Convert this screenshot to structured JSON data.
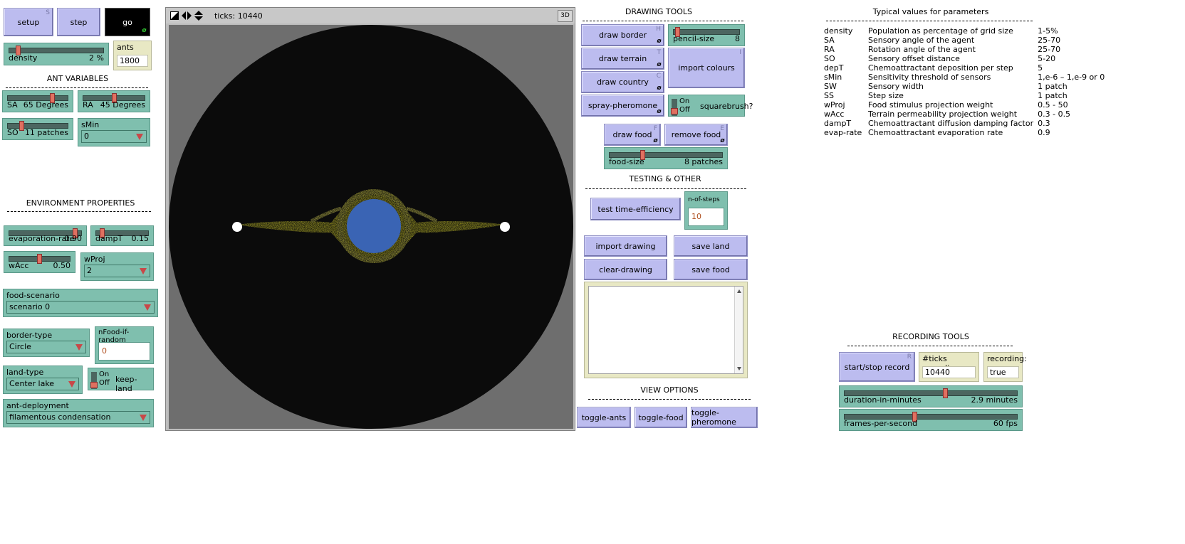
{
  "buttons": {
    "setup": {
      "label": "setup",
      "key": "S"
    },
    "step": {
      "label": "step"
    },
    "go": {
      "label": "go"
    }
  },
  "ants_monitor": {
    "label": "ants",
    "value": "1800"
  },
  "density": {
    "label": "density",
    "value": "2 %",
    "level": 0.02
  },
  "ant_variables_title": "ANT VARIABLES",
  "sa": {
    "label": "SA",
    "value": "65 Degrees",
    "level": 0.6
  },
  "ra": {
    "label": "RA",
    "value": "45 Degrees",
    "level": 0.45
  },
  "so": {
    "label": "SO",
    "value": "11 patches",
    "level": 0.2
  },
  "smin": {
    "label": "sMin",
    "value": "0"
  },
  "env_title": "ENVIRONMENT PROPERTIES",
  "evaporation": {
    "label": "evaporation-rate",
    "value": "0.90",
    "level": 0.9
  },
  "dampT": {
    "label": "dampT",
    "value": "0.15",
    "level": 0.05
  },
  "wAcc": {
    "label": "wAcc",
    "value": "0.50",
    "level": 0.5
  },
  "wProj": {
    "label": "wProj",
    "value": "2"
  },
  "food_scenario": {
    "label": "food-scenario",
    "value": "scenario 0"
  },
  "border_type": {
    "label": "border-type",
    "value": "Circle"
  },
  "nfood": {
    "label": "nFood-if-random",
    "value": "0"
  },
  "land_type": {
    "label": "land-type",
    "value": "Center lake"
  },
  "keep_land": {
    "label": "keep-land",
    "on": "On",
    "off": "Off"
  },
  "ant_deployment": {
    "label": "ant-deployment",
    "value": "filamentous condensation"
  },
  "view": {
    "ticks_label": "ticks: 10440",
    "three_d": "3D"
  },
  "drawing_title": "DRAWING TOOLS",
  "draw_border": {
    "label": "draw border",
    "key": "H"
  },
  "draw_terrain": {
    "label": "draw terrain",
    "key": "T"
  },
  "draw_country": {
    "label": "draw country",
    "key": "C"
  },
  "spray_pheromone": {
    "label": "spray-pheromone"
  },
  "pencil_size": {
    "label": "pencil-size",
    "value": "8",
    "level": 0.05
  },
  "import_colours": {
    "label": "import colours",
    "key": "I"
  },
  "squarebrush": {
    "label": "squarebrush?",
    "on": "On",
    "off": "Off"
  },
  "draw_food": {
    "label": "draw food",
    "key": "F"
  },
  "remove_food": {
    "label": "remove food",
    "key": "E"
  },
  "food_size": {
    "label": "food-size",
    "value": "8 patches",
    "level": 0.3
  },
  "testing_title": "TESTING & OTHER",
  "test_time": {
    "label": "test time-efficiency"
  },
  "n_of_steps": {
    "label": "n-of-steps",
    "value": "10"
  },
  "import_drawing": {
    "label": "import drawing"
  },
  "save_land": {
    "label": "save land"
  },
  "clear_drawing": {
    "label": "clear-drawing"
  },
  "save_food": {
    "label": "save food"
  },
  "view_options_title": "VIEW OPTIONS",
  "toggle_ants": {
    "label": "toggle-ants"
  },
  "toggle_food": {
    "label": "toggle-food"
  },
  "toggle_pheromone": {
    "label": "toggle-pheromone"
  },
  "params_title": "Typical values for parameters",
  "params": [
    {
      "name": "density",
      "desc": "Population as percentage of grid size",
      "value": "1-5%"
    },
    {
      "name": "SA",
      "desc": "Sensory angle of the agent",
      "value": "25-70"
    },
    {
      "name": "RA",
      "desc": "Rotation angle of the agent",
      "value": "25-70"
    },
    {
      "name": "SO",
      "desc": "Sensory offset distance",
      "value": "5-20"
    },
    {
      "name": "depT",
      "desc": "Chemoattractant deposition per step",
      "value": "5"
    },
    {
      "name": "sMin",
      "desc": "Sensitivity threshold of sensors",
      "value": "1,e-6 – 1,e-9 or 0"
    },
    {
      "name": "SW",
      "desc": "Sensory width",
      "value": "1 patch"
    },
    {
      "name": "SS",
      "desc": "Step size",
      "value": "1 patch"
    },
    {
      "name": "wProj",
      "desc": "Food stimulus projection weight",
      "value": "0.5 - 50"
    },
    {
      "name": "wAcc",
      "desc": "Terrain permeability projection weight",
      "value": "0.3 - 0.5"
    },
    {
      "name": "dampT",
      "desc": "Chemoattractant diffusion damping factor",
      "value": "0.3"
    },
    {
      "name": "evap-rate",
      "desc": "Chemoattractant evaporation rate",
      "value": "0.9"
    }
  ],
  "recording_title": "RECORDING TOOLS",
  "start_stop": {
    "label": "start/stop record",
    "key": "R"
  },
  "ticks_recording": {
    "label": "#ticks recording:",
    "value": "10440"
  },
  "recording": {
    "label": "recording:",
    "value": "true"
  },
  "duration": {
    "label": "duration-in-minutes",
    "value": "2.9 minutes",
    "level": 0.58
  },
  "fps": {
    "label": "frames-per-second",
    "value": "60 fps",
    "level": 0.41
  },
  "colors": {
    "widget_green": "#7fbfae",
    "button_purple": "#bcbcef",
    "monitor_yellow": "#e8e8c4",
    "lake_blue": "#3a64b4",
    "trail_yellow": "#e6e030"
  }
}
